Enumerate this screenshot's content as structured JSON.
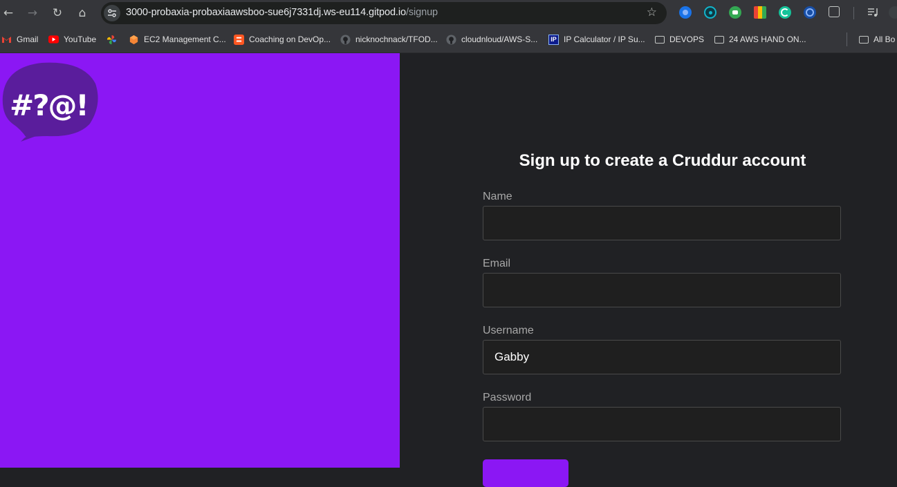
{
  "browser": {
    "nav": {
      "back_glyph": "←",
      "forward_glyph": "→",
      "reload_glyph": "↻",
      "home_glyph": "⌂"
    },
    "url_host": "3000-probaxia-probaxiaawsboo-sue6j7331dj.ws-eu114.gitpod.io",
    "url_path": "/signup",
    "bookmark_star": "☆",
    "bookmarks": [
      {
        "label": "Gmail",
        "icon": "gmail-icon"
      },
      {
        "label": "YouTube",
        "icon": "youtube-icon"
      },
      {
        "label": "",
        "icon": "photos-icon"
      },
      {
        "label": "EC2 Management C...",
        "icon": "aws-icon"
      },
      {
        "label": "Coaching on DevOp...",
        "icon": "blogger-icon"
      },
      {
        "label": "nicknochnack/TFOD...",
        "icon": "github-icon"
      },
      {
        "label": "cloudnloud/AWS-S...",
        "icon": "github-icon"
      },
      {
        "label": "IP Calculator / IP Su...",
        "icon": "ip-icon"
      },
      {
        "label": "DEVOPS",
        "icon": "folder-icon"
      },
      {
        "label": "24 AWS HAND ON...",
        "icon": "folder-icon"
      },
      {
        "label": "All Bo",
        "icon": "folder-icon"
      }
    ],
    "ip_badge": "IP"
  },
  "brand": {
    "logo_text": "#?@!",
    "accent": "#8b17f4",
    "bubble": "#5a1d9c"
  },
  "form": {
    "title": "Sign up to create a Cruddur account",
    "name_label": "Name",
    "name_value": "",
    "email_label": "Email",
    "email_value": "",
    "username_label": "Username",
    "username_value": "Gabby",
    "password_label": "Password",
    "password_value": ""
  }
}
